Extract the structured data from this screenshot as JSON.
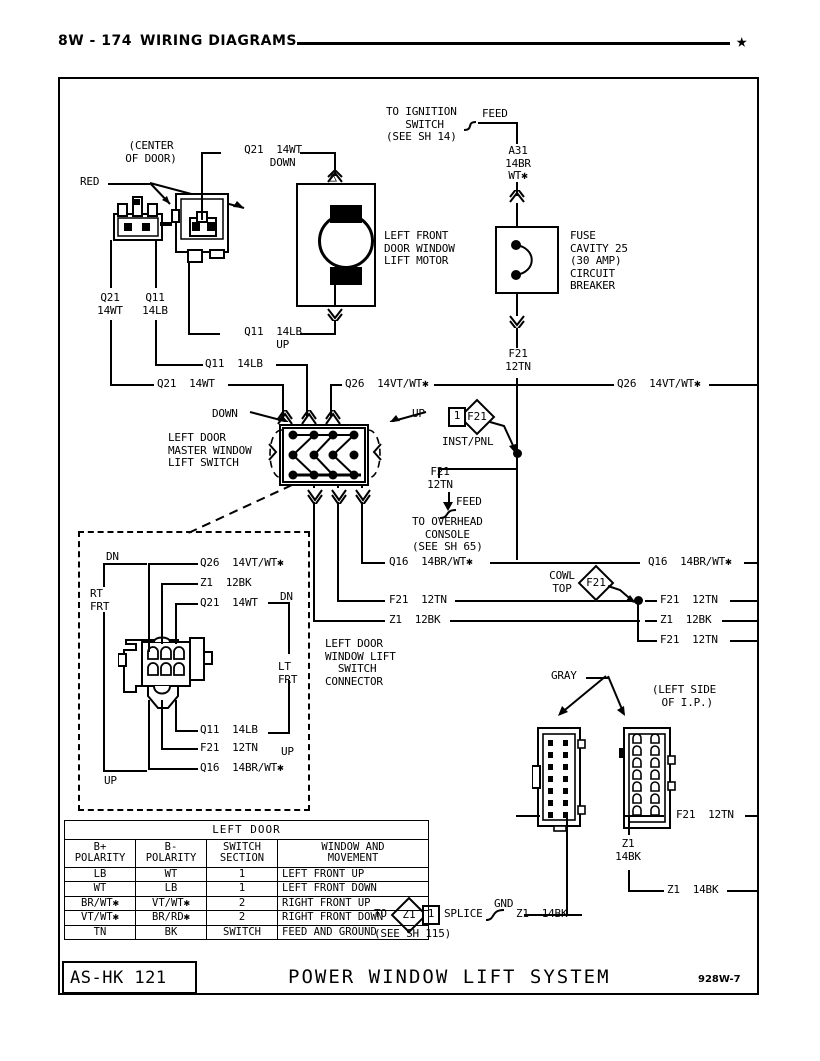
{
  "header": {
    "page_number": "8W - 174",
    "title": "WIRING DIAGRAMS",
    "star_icon": "★"
  },
  "footer": {
    "code": "AS-HK 121",
    "title": "POWER WINDOW LIFT SYSTEM",
    "revision": "928W-7"
  },
  "labels": {
    "center_of_door": "(CENTER\nOF DOOR)",
    "red": "RED",
    "q21_14wt_down_top": "Q21  14WT\n   DOWN",
    "q11_14lb_up_mid": "Q11  14LB\n   UP",
    "motor": "LEFT FRONT\nDOOR WINDOW\nLIFT MOTOR",
    "q21_14wt_vert": "Q21\n14WT",
    "q11_14lb_vert": "Q11\n14LB",
    "q11_14lb_bus": "Q11  14LB",
    "q21_14wt_bus": "Q21  14WT",
    "q26_14vtwt_left": "Q26  14VT/WT✱",
    "q26_14vtwt_right": "Q26  14VT/WT✱",
    "down": "DOWN",
    "up": "UP",
    "master_switch": "LEFT DOOR\nMASTER WINDOW\nLIFT SWITCH",
    "to_ignition": "TO IGNITION\n   SWITCH\n(SEE SH 14)",
    "feed_top": "FEED",
    "a31": "A31\n14BR\nWT✱",
    "breaker": "FUSE\nCAVITY 25\n(30 AMP)\nCIRCUIT\nBREAKER",
    "f21_12tn_breaker": "F21\n12TN",
    "splice_inst_num": "1",
    "splice_inst_code": "F21",
    "inst_pnl": "INST/PNL",
    "f21_12tn_inst": "F21\n12TN",
    "feed_overhead": "FEED",
    "to_overhead": "TO OVERHEAD\n  CONSOLE\n(SEE SH 65)",
    "q16_left": "Q16  14BR/WT✱",
    "q16_right": "Q16  14BR/WT✱",
    "f21_12tn_row_left": "F21  12TN",
    "z1_12bk_row_left": "Z1  12BK",
    "cowl_top": "COWL\nTOP",
    "cowl_splice_code": "F21",
    "f21_12tn_r1": "F21  12TN",
    "z1_12bk_r2": "Z1  12BK",
    "f21_12tn_r3": "F21  12TN",
    "connector_title": "LEFT DOOR\nWINDOW LIFT\n  SWITCH\nCONNECTOR",
    "dn": "DN",
    "rt_frt": "RT\nFRT",
    "lt_frt": "LT\nFRT",
    "dn_right": "DN",
    "up_right": "UP",
    "up_bottom": "UP",
    "c_q26": "Q26  14VT/WT✱",
    "c_z1_12bk": "Z1  12BK",
    "c_q21": "Q21  14WT",
    "c_q11": "Q11  14LB",
    "c_f21": "F21  12TN",
    "c_q16": "Q16  14BR/WT✱",
    "gray": "GRAY",
    "left_side_ip": "(LEFT SIDE\n OF I.P.)",
    "f21_12tn_conn": "F21  12TN",
    "f21_12tn_conn_right": "F21  12TN",
    "z1_14bk_vert": "Z1\n14BK",
    "z1_14bk_mid": "Z1  14BK",
    "z1_14bk_right": "Z1  14BK",
    "to_splice": "TO",
    "splice_z1_code": "Z1",
    "splice_z1_num": "1",
    "splice_word": "SPLICE",
    "see_sh_115": "(SEE SH 115)",
    "gnd": "GND",
    "z1_14bk_gnd": "Z1  14BK"
  },
  "table": {
    "title": "LEFT DOOR",
    "columns": [
      "B+\nPOLARITY",
      "B-\nPOLARITY",
      "SWITCH\nSECTION",
      "WINDOW AND\nMOVEMENT"
    ],
    "rows": [
      [
        "LB",
        "WT",
        "1",
        "LEFT FRONT UP"
      ],
      [
        "WT",
        "LB",
        "1",
        "LEFT FRONT DOWN"
      ],
      [
        "BR/WT✱",
        "VT/WT✱",
        "2",
        "RIGHT FRONT UP"
      ],
      [
        "VT/WT✱",
        "BR/RD✱",
        "2",
        "RIGHT FRONT DOWN"
      ],
      [
        "TN",
        "BK",
        "SWITCH",
        "FEED AND GROUND"
      ]
    ]
  },
  "colors": {
    "ink": "#000000",
    "paper": "#ffffff"
  }
}
